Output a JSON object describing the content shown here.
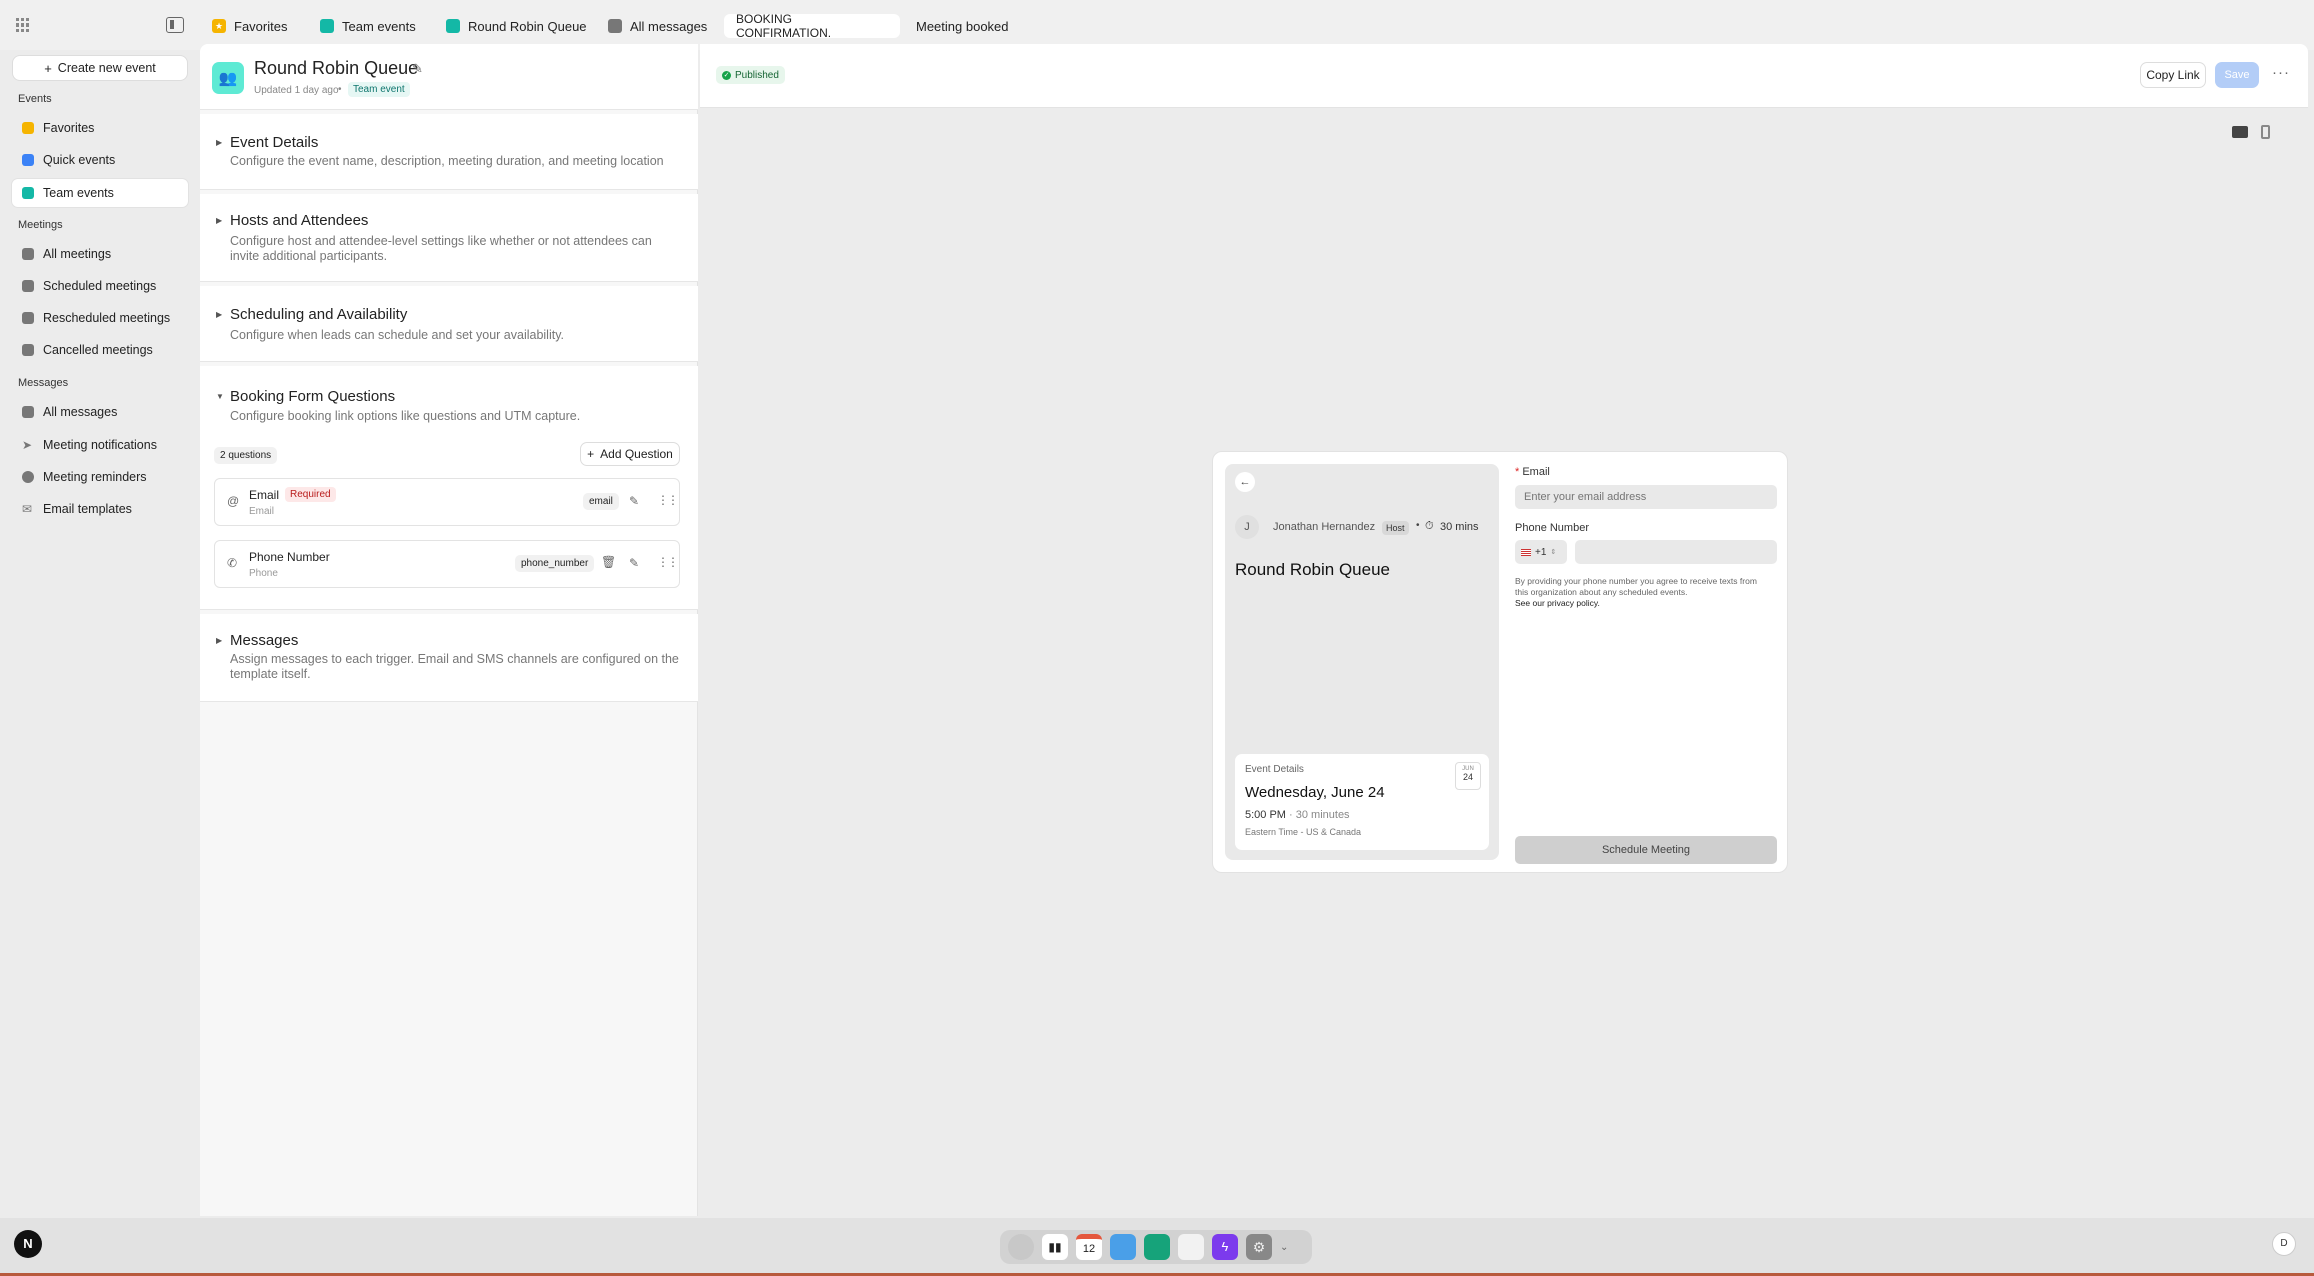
{
  "tabs": [
    {
      "label": "Favorites",
      "color": "#f5b400"
    },
    {
      "label": "Team events",
      "color": "#14b8a6"
    },
    {
      "label": "Round Robin Queue",
      "color": "#14b8a6"
    },
    {
      "label": "All messages",
      "color": "#777777"
    },
    {
      "label": "BOOKING CONFIRMATION.",
      "color": ""
    },
    {
      "label": "Meeting booked",
      "color": ""
    }
  ],
  "sidebar": {
    "create_label": "Create new event",
    "groups": [
      {
        "heading": "Events",
        "items": [
          "Favorites",
          "Quick events",
          "Team events"
        ]
      },
      {
        "heading": "Meetings",
        "items": [
          "All meetings",
          "Scheduled meetings",
          "Rescheduled meetings",
          "Cancelled meetings"
        ]
      },
      {
        "heading": "Messages",
        "items": [
          "All messages",
          "Meeting notifications",
          "Meeting reminders",
          "Email templates"
        ]
      }
    ],
    "active_item": "Team events"
  },
  "event": {
    "title": "Round Robin Queue",
    "updated": "Updated 1 day ago",
    "badge": "Team event",
    "status": "Published",
    "copy_link": "Copy Link",
    "save": "Save"
  },
  "sections": [
    {
      "title": "Event Details",
      "desc": "Configure the event name, description, meeting duration, and meeting location"
    },
    {
      "title": "Hosts and Attendees",
      "desc": "Configure host and attendee-level settings like whether or not attendees can invite additional participants."
    },
    {
      "title": "Scheduling and Availability",
      "desc": "Configure when leads can schedule and set your availability."
    },
    {
      "title": "Booking Form Questions",
      "desc": "Configure booking link options like questions and UTM capture."
    },
    {
      "title": "Messages",
      "desc": "Assign messages to each trigger. Email and SMS channels are configured on the template itself."
    }
  ],
  "questions": {
    "count_label": "2 questions",
    "add_label": "Add Question",
    "items": [
      {
        "label": "Email",
        "sub": "Email",
        "required": "Required",
        "key": "email"
      },
      {
        "label": "Phone Number",
        "sub": "Phone",
        "required": "",
        "key": "phone_number"
      }
    ]
  },
  "preview": {
    "avatar": "J",
    "host_name": "Jonathan Hernandez",
    "host_badge": "Host",
    "duration": "30 mins",
    "title": "Round Robin Queue",
    "details_label": "Event Details",
    "month": "JUN",
    "day": "24",
    "date": "Wednesday, June 24",
    "time": "5:00 PM",
    "length": "· 30 minutes",
    "tz": "Eastern Time - US & Canada",
    "email_label": "Email",
    "email_required_mark": "*",
    "email_placeholder": "Enter your email address",
    "phone_label": "Phone Number",
    "country": "+1",
    "consent": "By providing your phone number you agree to receive texts from this organization about any scheduled events.",
    "privacy": "See our privacy policy.",
    "submit": "Schedule Meeting"
  },
  "user_initial": "D",
  "dock_badge": "12",
  "colors": {
    "accent": "#14b8a6",
    "favorite": "#f5b400",
    "blue": "#3b82f6"
  }
}
